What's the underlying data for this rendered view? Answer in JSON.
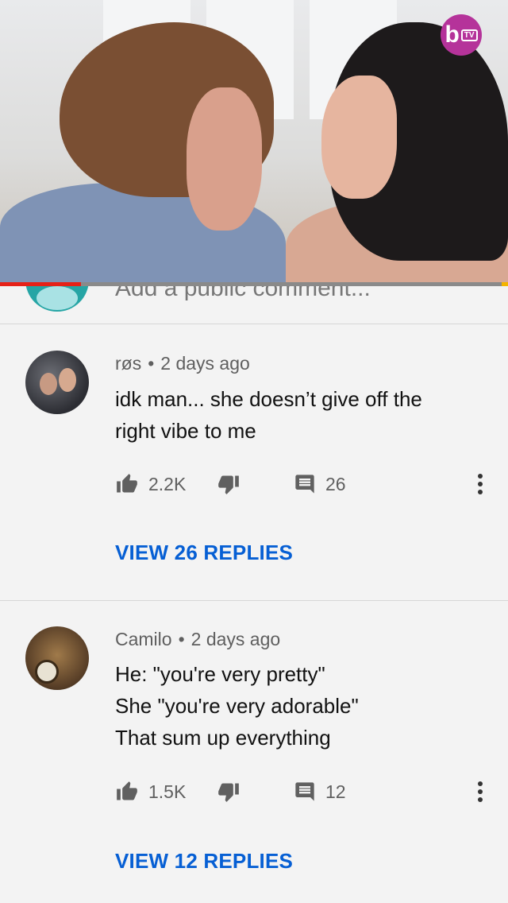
{
  "add_comment": {
    "placeholder": "Add a public comment..."
  },
  "comments": [
    {
      "author": "røs",
      "time": "2 days ago",
      "lines": [
        "idk man... she doesn’t give off the",
        "right vibe to me"
      ],
      "likes": "2.2K",
      "reply_count": "26",
      "view_replies_label": "VIEW 26 REPLIES"
    },
    {
      "author": "Camilo",
      "time": "2 days ago",
      "lines": [
        "He: \"you're very pretty\"",
        "She \"you're very adorable\"",
        "That sum up everything"
      ],
      "likes": "1.5K",
      "reply_count": "12",
      "view_replies_label": "VIEW 12 REPLIES"
    }
  ],
  "video": {
    "watched_fraction": 0.16
  },
  "colors": {
    "link_blue": "#065fd4",
    "progress_red": "#e62117",
    "logo_purple": "#b5339a"
  },
  "icons": [
    "thumbs-up-icon",
    "thumbs-down-icon",
    "reply-icon",
    "more-vert-icon"
  ]
}
